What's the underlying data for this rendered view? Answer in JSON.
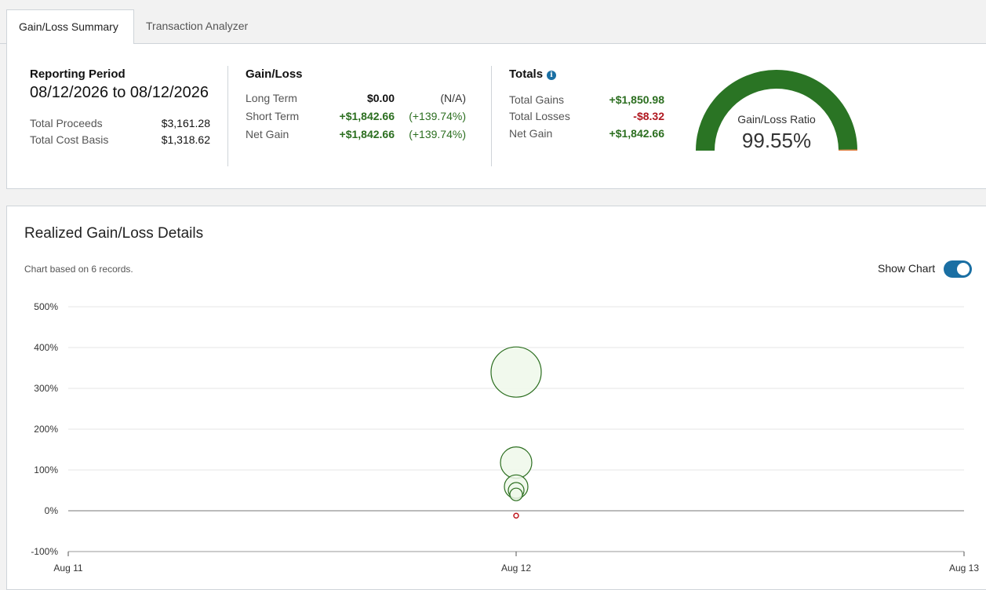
{
  "tabs": [
    {
      "label": "Gain/Loss Summary",
      "active": true
    },
    {
      "label": "Transaction Analyzer",
      "active": false
    }
  ],
  "reporting": {
    "heading": "Reporting Period",
    "period": "08/12/2026 to 08/12/2026",
    "rows": [
      {
        "label": "Total Proceeds",
        "value": "$3,161.28"
      },
      {
        "label": "Total Cost Basis",
        "value": "$1,318.62"
      }
    ]
  },
  "gain_loss": {
    "heading": "Gain/Loss",
    "rows": [
      {
        "label": "Long Term",
        "value": "$0.00",
        "pct": "(N/A)"
      },
      {
        "label": "Short Term",
        "value": "+$1,842.66",
        "pct": "(+139.74%)"
      },
      {
        "label": "Net Gain",
        "value": "+$1,842.66",
        "pct": "(+139.74%)"
      }
    ]
  },
  "totals": {
    "heading": "Totals",
    "info_icon": "info-icon",
    "rows": [
      {
        "label": "Total Gains",
        "value": "+$1,850.98"
      },
      {
        "label": "Total Losses",
        "value": "-$8.32"
      },
      {
        "label": "Net Gain",
        "value": "+$1,842.66"
      }
    ]
  },
  "gauge": {
    "label": "Gain/Loss Ratio",
    "value": "99.55%",
    "ratio": 0.9955,
    "gain_color": "#2a7424",
    "loss_color": "#e07a3a"
  },
  "details": {
    "title": "Realized Gain/Loss Details",
    "records_note": "Chart based on 6 records.",
    "show_chart_label": "Show Chart",
    "show_chart_on": true
  },
  "chart_data": {
    "type": "scatter",
    "y_ticks": [
      "500%",
      "400%",
      "300%",
      "200%",
      "100%",
      "0%",
      "-100%"
    ],
    "x_ticks": [
      "Aug 11",
      "Aug 12",
      "Aug 13"
    ],
    "ylim": [
      -100,
      500
    ],
    "grid": true,
    "points": [
      {
        "x": "Aug 12",
        "y": 340,
        "size": 32,
        "sign": "gain"
      },
      {
        "x": "Aug 12",
        "y": 118,
        "size": 20,
        "sign": "gain"
      },
      {
        "x": "Aug 12",
        "y": 59,
        "size": 15,
        "sign": "gain"
      },
      {
        "x": "Aug 12",
        "y": 50,
        "size": 10,
        "sign": "gain"
      },
      {
        "x": "Aug 12",
        "y": 40,
        "size": 8,
        "sign": "gain"
      },
      {
        "x": "Aug 12",
        "y": -12,
        "size": 3,
        "sign": "loss"
      }
    ],
    "gain_color": "#2b6e1f",
    "gain_fill": "#eef8ea",
    "loss_color": "#c0191f"
  }
}
